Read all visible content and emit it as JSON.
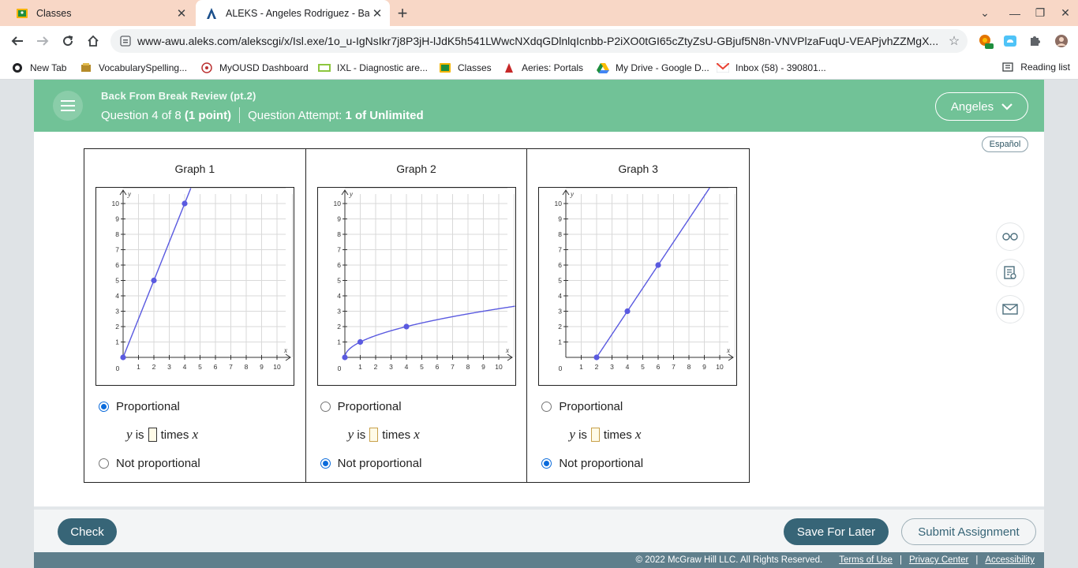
{
  "browser": {
    "tabs": [
      {
        "title": "Classes",
        "icon": "google-classroom-icon",
        "active": false
      },
      {
        "title": "ALEKS - Angeles Rodriguez - Back",
        "icon": "aleks-icon",
        "active": true
      }
    ],
    "url": "www-awu.aleks.com/alekscgi/x/Isl.exe/1o_u-IgNsIkr7j8P3jH-lJdK5h541LWwcNXdqGDlnlqIcnbb-P2iXO0tGI65cZtyZsU-GBjuf5N8n-VNVPlzaFuqU-VEAPjvhZZMgX...",
    "bookmarks": [
      {
        "label": "New Tab"
      },
      {
        "label": "VocabularySpelling..."
      },
      {
        "label": "MyOUSD Dashboard"
      },
      {
        "label": "IXL - Diagnostic are..."
      },
      {
        "label": "Classes"
      },
      {
        "label": "Aeries: Portals"
      },
      {
        "label": "My Drive - Google D..."
      },
      {
        "label": "Inbox (58) - 390801..."
      }
    ],
    "reading_list": "Reading list"
  },
  "header": {
    "assignment": "Back From Break Review (pt.2)",
    "question_prefix": "Question 4 of 8",
    "question_points": "(1 point)",
    "attempt_label": "Question Attempt:",
    "attempt_value": "1 of Unlimited",
    "user": "Angeles",
    "accent": "#71c297"
  },
  "espanol": "Español",
  "graphs": [
    {
      "title": "Graph 1",
      "proportional": "Proportional",
      "not_proportional": "Not proportional",
      "selected": "proportional"
    },
    {
      "title": "Graph 2",
      "proportional": "Proportional",
      "not_proportional": "Not proportional",
      "selected": "not_proportional"
    },
    {
      "title": "Graph 3",
      "proportional": "Proportional",
      "not_proportional": "Not proportional",
      "selected": "not_proportional"
    }
  ],
  "equation": {
    "y": "y",
    "is": "is",
    "times": "times",
    "x": "x"
  },
  "chart_data": [
    {
      "type": "line",
      "title": "Graph 1",
      "xlabel": "x",
      "ylabel": "y",
      "xlim": [
        0,
        10
      ],
      "ylim": [
        0,
        10
      ],
      "grid": true,
      "xticks": [
        "1",
        "2",
        "3",
        "4",
        "5",
        "6",
        "7",
        "8",
        "9",
        "10"
      ],
      "yticks": [
        "1",
        "2",
        "3",
        "4",
        "5",
        "6",
        "7",
        "8",
        "9",
        "10"
      ],
      "origin": "0",
      "points": [
        [
          0,
          0
        ],
        [
          2,
          5
        ],
        [
          4,
          10
        ]
      ],
      "line": "y = 2.5x"
    },
    {
      "type": "line",
      "title": "Graph 2",
      "xlabel": "x",
      "ylabel": "y",
      "xlim": [
        0,
        10
      ],
      "ylim": [
        0,
        10
      ],
      "grid": true,
      "xticks": [
        "1",
        "2",
        "3",
        "4",
        "5",
        "6",
        "7",
        "8",
        "9",
        "10"
      ],
      "yticks": [
        "1",
        "2",
        "3",
        "4",
        "5",
        "6",
        "7",
        "8",
        "9",
        "10"
      ],
      "origin": "0",
      "points": [
        [
          0,
          0
        ],
        [
          1,
          1
        ],
        [
          4,
          2
        ]
      ],
      "line": "y = sqrt(x)"
    },
    {
      "type": "line",
      "title": "Graph 3",
      "xlabel": "x",
      "ylabel": "y",
      "xlim": [
        0,
        10
      ],
      "ylim": [
        0,
        10
      ],
      "grid": true,
      "xticks": [
        "1",
        "2",
        "3",
        "4",
        "5",
        "6",
        "7",
        "8",
        "9",
        "10"
      ],
      "yticks": [
        "1",
        "2",
        "3",
        "4",
        "5",
        "6",
        "7",
        "8",
        "9",
        "10"
      ],
      "origin": "0",
      "points": [
        [
          2,
          0
        ],
        [
          4,
          3
        ],
        [
          6,
          6
        ]
      ],
      "line": "y = 1.5x - 3"
    }
  ],
  "footer": {
    "check": "Check",
    "save": "Save For Later",
    "submit": "Submit Assignment",
    "copyright": "© 2022 McGraw Hill LLC. All Rights Reserved.",
    "terms": "Terms of Use",
    "privacy": "Privacy Center",
    "accessibility": "Accessibility",
    "bar_color": "#376577"
  }
}
